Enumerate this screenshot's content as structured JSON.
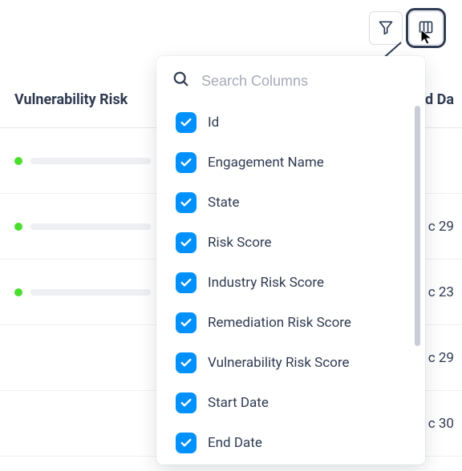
{
  "toolbar": {
    "filter_name": "filter-icon",
    "columns_name": "columns-icon"
  },
  "headers": {
    "left": "Vulnerability Risk",
    "right": "d Da"
  },
  "rows": [
    {
      "right": ""
    },
    {
      "right": "c 29"
    },
    {
      "right": "c 23"
    },
    {
      "right": "c 29"
    },
    {
      "right": "c 30"
    }
  ],
  "panel": {
    "search_placeholder": "Search Columns",
    "items": [
      {
        "label": "Id",
        "checked": true
      },
      {
        "label": "Engagement Name",
        "checked": true
      },
      {
        "label": "State",
        "checked": true
      },
      {
        "label": "Risk Score",
        "checked": true
      },
      {
        "label": "Industry Risk Score",
        "checked": true
      },
      {
        "label": "Remediation Risk Score",
        "checked": true
      },
      {
        "label": "Vulnerability Risk Score",
        "checked": true
      },
      {
        "label": "Start Date",
        "checked": true
      },
      {
        "label": "End Date",
        "checked": true
      }
    ]
  }
}
